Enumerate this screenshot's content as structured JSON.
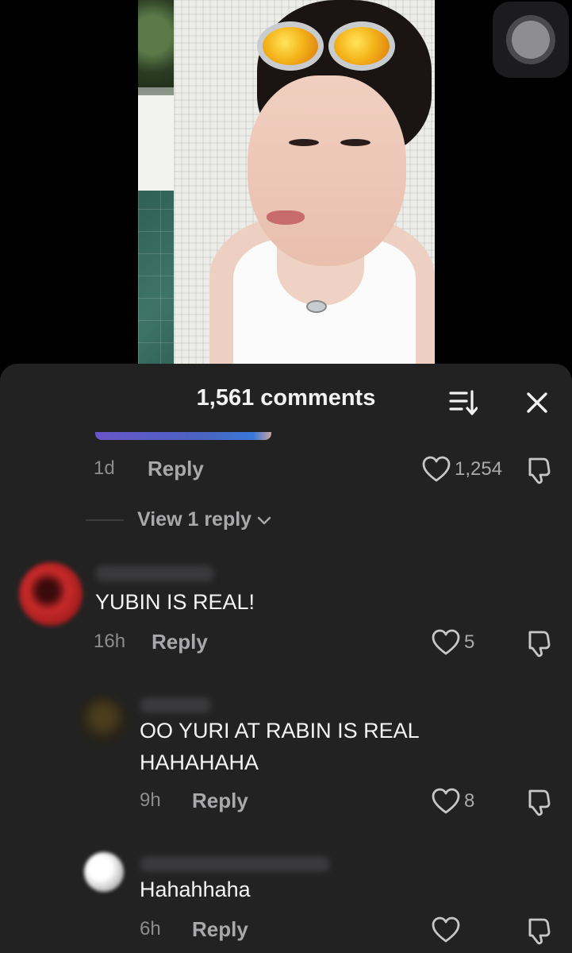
{
  "video": {
    "description_hidden": true
  },
  "record_button": {
    "icon": "record-icon"
  },
  "sheet": {
    "title": "1,561 comments",
    "sort_icon": "sort-icon",
    "close_icon": "close-icon"
  },
  "comments": [
    {
      "time": "1d",
      "reply_label": "Reply",
      "likes": "1,254",
      "view_replies": "View 1 reply"
    },
    {
      "text": "YUBIN IS REAL!",
      "time": "16h",
      "reply_label": "Reply",
      "likes": "5"
    },
    {
      "text_line1": "OO YURI AT RABIN IS REAL",
      "text_line2": "HAHAHAHA",
      "time": "9h",
      "reply_label": "Reply",
      "likes": "8"
    },
    {
      "text": "Hahahhaha",
      "time": "6h",
      "reply_label": "Reply",
      "likes": ""
    }
  ],
  "colors": {
    "sheet_bg": "#222222",
    "muted_text": "#a9a9ab",
    "time_text": "#8d8d8f"
  }
}
